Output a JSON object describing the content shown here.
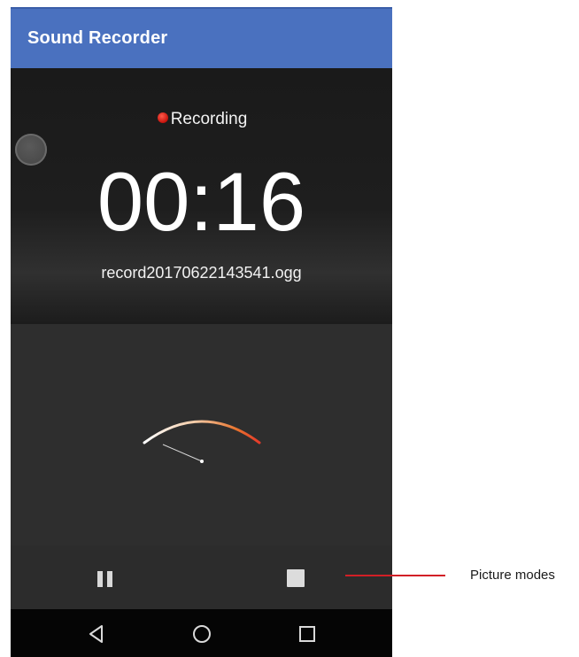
{
  "app_bar": {
    "title": "Sound Recorder",
    "color": "#4a71bf"
  },
  "recorder": {
    "status_label": "Recording",
    "status_icon": "record-dot-icon",
    "status_color": "#c5130c",
    "elapsed_time": "00:16",
    "file_name": "record20170622143541.ogg"
  },
  "meter": {
    "icon": "vu-meter-gauge",
    "arc_start_color": "#ffffff",
    "arc_end_color": "#e53a2a"
  },
  "controls": {
    "pause_icon": "pause-icon",
    "stop_icon": "stop-icon"
  },
  "nav_bar": {
    "back_icon": "back-triangle-icon",
    "home_icon": "home-circle-icon",
    "recents_icon": "recents-square-icon"
  },
  "annotation": {
    "label": "Picture modes",
    "line_color": "#d21f26"
  }
}
